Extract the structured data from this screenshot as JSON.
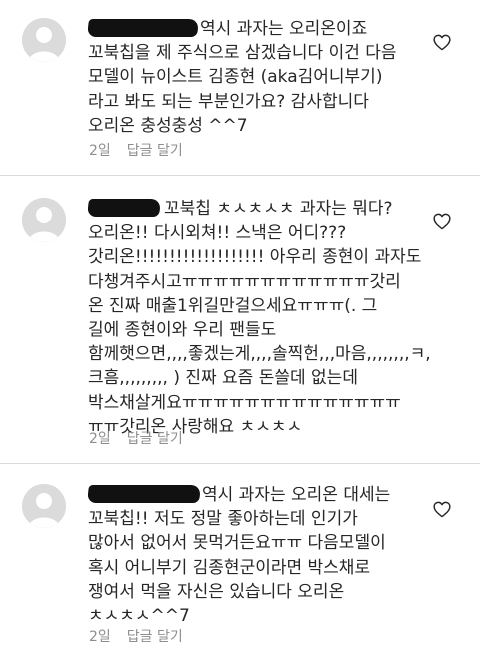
{
  "comments": [
    {
      "lines": [
        "역시 과자는 오리온이죠",
        "꼬북칩을 제 주식으로 삼겠습니다 이건 다음",
        "모델이 뉴이스트 김종현 (aka김어니부기)",
        "라고 봐도 되는 부분인가요? 감사합니다",
        "오리온 충성충성 ^^7"
      ],
      "time": "2일",
      "reply": "답글 달기"
    },
    {
      "lines": [
        "꼬북칩 ㅊㅅㅊㅅㅊ 과자는 뭐다?",
        "오리온!! 다시외쳐!! 스낵은 어디???",
        "갓리온!!!!!!!!!!!!!!!!!!! 아우리 종현이 과자도",
        "다챙겨주시고ㅠㅠㅠㅠㅠㅠㅠㅠㅠㅠㅠㅠ갓리",
        "온 진짜 매출1위길만걸으세요ㅠㅠㅠ(. 그",
        "길에 종현이와 우리 팬들도",
        "함께햇으면,,,,좋겠는게,,,,솔찍헌,,,마음,,,,,,,,ㅋ,",
        "크흠,,,,,,,,, ) 진짜 요즘 돈쓸데 없는데",
        "박스채살게요ㅠㅠㅠㅠㅠㅠㅠㅠㅠㅠㅠㅠㅠㅠ",
        "ㅠㅠ갓리온 사랑해요 ㅊㅅㅊㅅ"
      ],
      "time": "2일",
      "reply": "답글 달기"
    },
    {
      "lines": [
        "역시 과자는 오리온 대세는",
        "꼬북칩!! 저도 정말 좋아하는데 인기가",
        "많아서 없어서 못먹거든요ㅠㅠ 다음모델이",
        "혹시 어니부기 김종현군이라면 박스채로",
        "쟁여서 먹을 자신은 있습니다 오리온",
        "ㅊㅅㅊㅅ^^7"
      ],
      "time": "2일",
      "reply": "답글 달기"
    }
  ],
  "icons": {
    "avatar": "default-avatar-icon",
    "like": "heart-outline-icon"
  },
  "colors": {
    "text": "#262626",
    "meta": "#8e8e8e",
    "avatar_bg": "#dbdbdb",
    "divider": "#dbdbdb"
  }
}
